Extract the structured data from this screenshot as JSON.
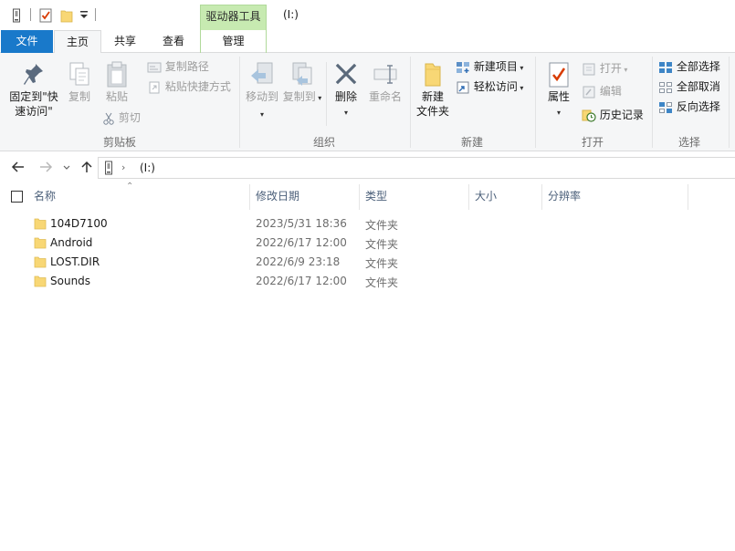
{
  "window": {
    "title": "(I:)",
    "context_tab_group": "驱动器工具"
  },
  "tabs": {
    "file": "文件",
    "home": "主页",
    "share": "共享",
    "view": "查看",
    "manage": "管理"
  },
  "ribbon": {
    "clipboard": {
      "label": "剪贴板",
      "pin_line1": "固定到\"快",
      "pin_line2": "速访问\"",
      "copy": "复制",
      "paste": "粘贴",
      "copy_path": "复制路径",
      "paste_shortcut": "粘贴快捷方式",
      "cut": "剪切"
    },
    "organize": {
      "label": "组织",
      "move_to": "移动到",
      "copy_to": "复制到",
      "delete": "删除",
      "rename": "重命名"
    },
    "new": {
      "label": "新建",
      "new_folder_line1": "新建",
      "new_folder_line2": "文件夹",
      "new_item": "新建项目",
      "easy_access": "轻松访问"
    },
    "open": {
      "label": "打开",
      "properties": "属性",
      "open": "打开",
      "edit": "编辑",
      "history": "历史记录"
    },
    "select": {
      "label": "选择",
      "select_all": "全部选择",
      "select_none": "全部取消",
      "invert": "反向选择"
    }
  },
  "address": {
    "path": "(I:)"
  },
  "columns": {
    "name": "名称",
    "date": "修改日期",
    "type": "类型",
    "size": "大小",
    "resolution": "分辨率"
  },
  "files": [
    {
      "name": "104D7100",
      "date": "2023/5/31 18:36",
      "type": "文件夹"
    },
    {
      "name": "Android",
      "date": "2022/6/17 12:00",
      "type": "文件夹"
    },
    {
      "name": "LOST.DIR",
      "date": "2022/6/9 23:18",
      "type": "文件夹"
    },
    {
      "name": "Sounds",
      "date": "2022/6/17 12:00",
      "type": "文件夹"
    }
  ],
  "colors": {
    "accent": "#1979ca",
    "context_tab": "#c7eab1",
    "folder": "#f8d775"
  }
}
